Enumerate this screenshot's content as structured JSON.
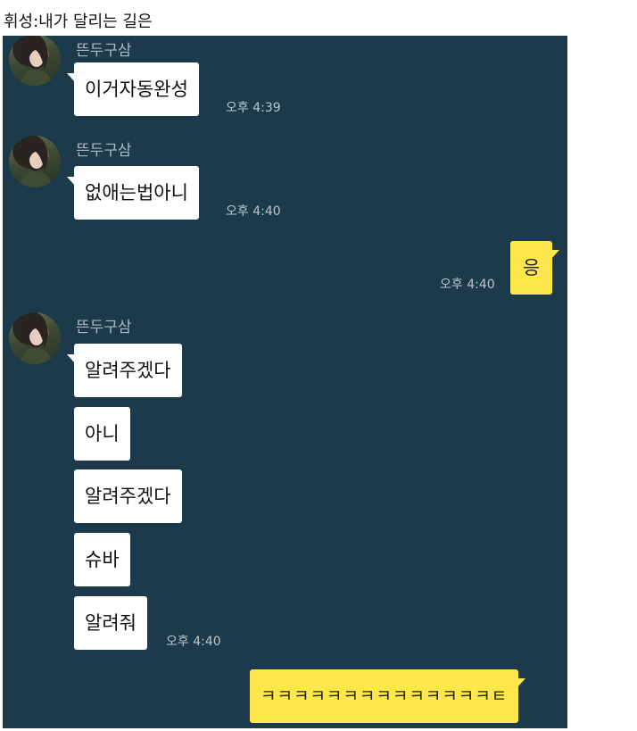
{
  "caption": "휘성:내가 달리는 길은",
  "contact_name": "뜬두구삼",
  "messages": [
    {
      "text": "이거자동완성",
      "time": "오후 4:39"
    },
    {
      "text": "없애는법아니",
      "time": "오후 4:40"
    },
    {
      "text": "응",
      "time": "오후 4:40"
    },
    {
      "text": "알려주겠다"
    },
    {
      "text": "아니"
    },
    {
      "text": "알려주겠다"
    },
    {
      "text": "슈바"
    },
    {
      "text": "알려줘",
      "time": "오후 4:40"
    },
    {
      "text": "ㅋㅋㅋㅋㅋㅋㅋㅋㅋㅋㅋㅋㅋㅋㅌ"
    }
  ],
  "colors": {
    "chat_background": "#1c3a4b",
    "incoming_bubble": "#ffffff",
    "outgoing_bubble": "#fde74a"
  }
}
